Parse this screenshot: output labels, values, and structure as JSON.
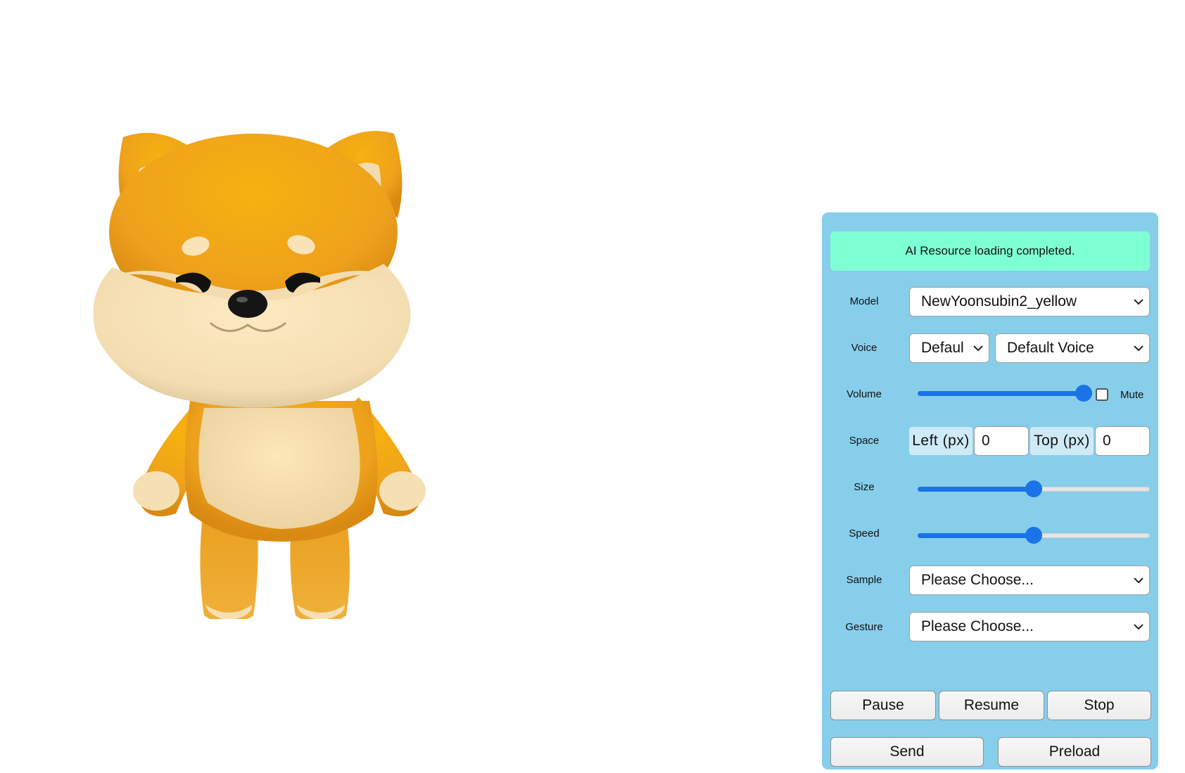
{
  "status": {
    "message": "AI Resource loading completed."
  },
  "controls": {
    "model": {
      "label": "Model",
      "selected": "NewYoonsubin2_yellow"
    },
    "voice": {
      "label": "Voice",
      "language_selected": "Defaul",
      "voice_selected": "Default Voice"
    },
    "volume": {
      "label": "Volume",
      "level": 1.0,
      "mute_label": "Mute",
      "muted": false
    },
    "space": {
      "label": "Space",
      "left_label": "Left (px)",
      "left_value": "0",
      "top_label": "Top (px)",
      "top_value": "0"
    },
    "size": {
      "label": "Size",
      "level": 0.5
    },
    "speed": {
      "label": "Speed",
      "level": 0.5
    },
    "sample": {
      "label": "Sample",
      "selected": "Please Choose..."
    },
    "gesture": {
      "label": "Gesture",
      "selected": "Please Choose..."
    }
  },
  "buttons": {
    "pause": "Pause",
    "resume": "Resume",
    "stop": "Stop",
    "send": "Send",
    "preload": "Preload"
  },
  "icons": {
    "dropdown": "chevron-down-icon",
    "avatar": "shiba-inu-character"
  },
  "colors": {
    "panel": "#87ceeb",
    "status_bg": "#7fffd4",
    "accent": "#1a73e8",
    "fur": "#f3a611",
    "cream": "#f8e3b8"
  }
}
